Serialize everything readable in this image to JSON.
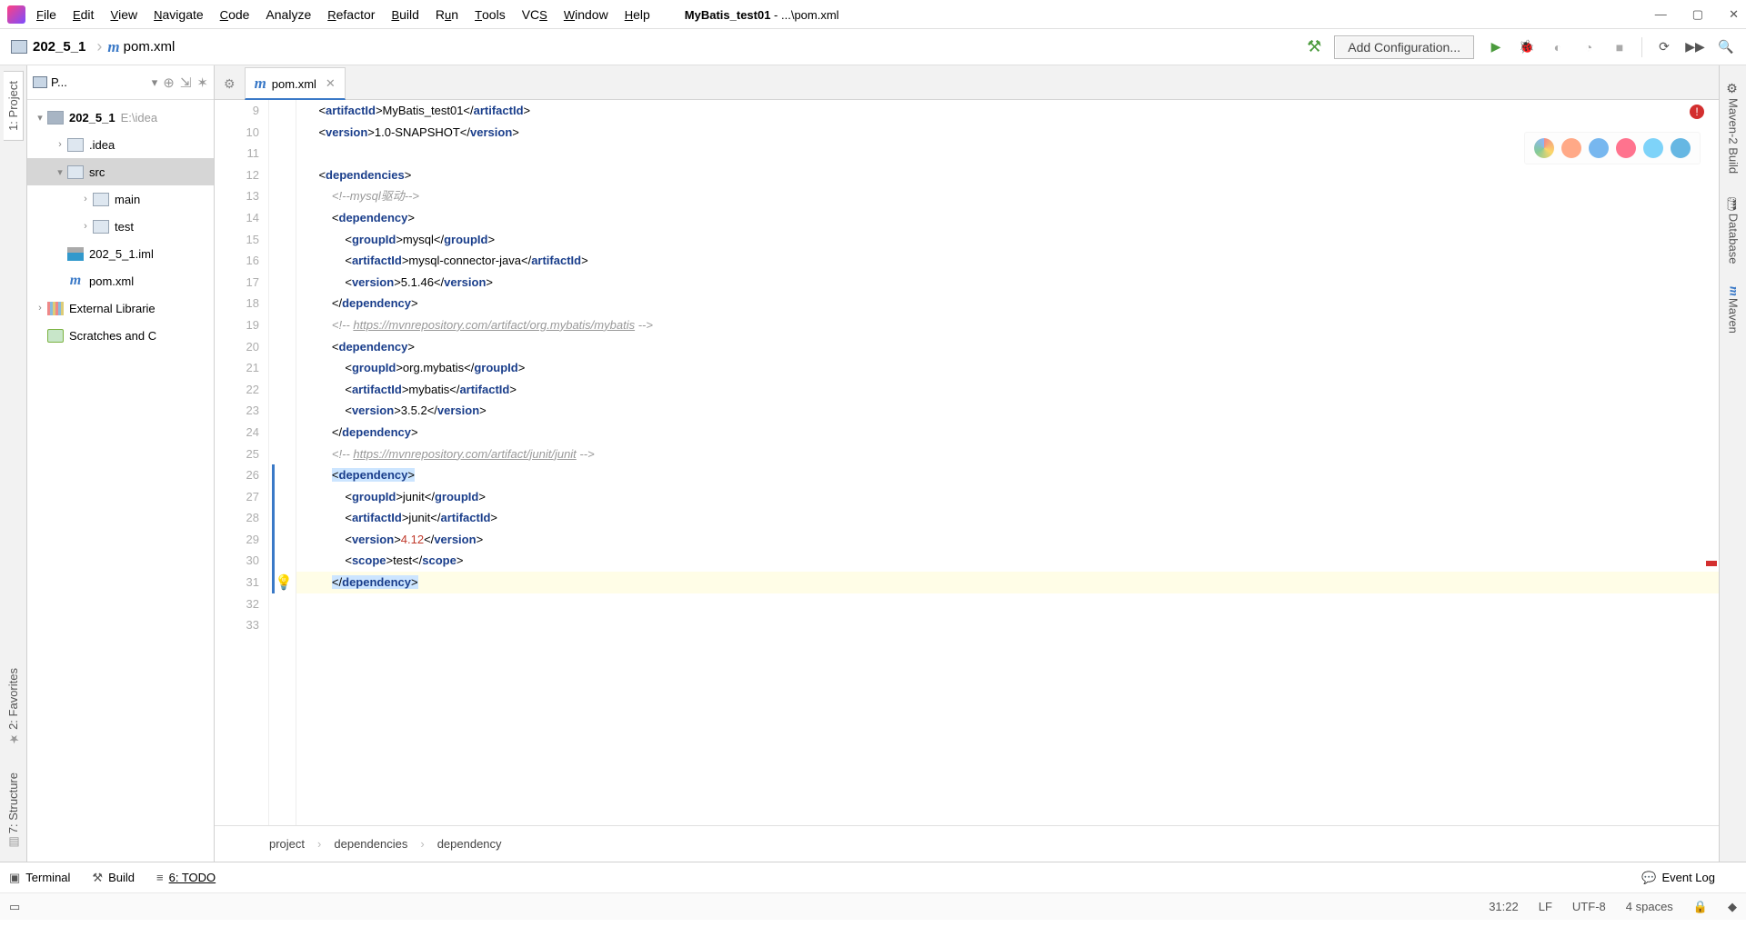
{
  "menu": {
    "items": [
      "File",
      "Edit",
      "View",
      "Navigate",
      "Code",
      "Analyze",
      "Refactor",
      "Build",
      "Run",
      "Tools",
      "VCS",
      "Window",
      "Help"
    ],
    "accel": [
      "F",
      "E",
      "V",
      "N",
      "C",
      "",
      "R",
      "B",
      "u",
      "T",
      "S",
      "W",
      "H"
    ],
    "title_project": "MyBatis_test01",
    "title_suffix": " - ...\\pom.xml"
  },
  "nav": {
    "project": "202_5_1",
    "file": "pom.xml",
    "addConfig": "Add Configuration..."
  },
  "leftTabs": {
    "project": "1: Project",
    "favorites": "2: Favorites",
    "structure": "7: Structure"
  },
  "rightTabs": {
    "mavenBuild": "Maven-2 Build",
    "database": "Database",
    "maven": "Maven"
  },
  "projectPane": {
    "title": "P...",
    "root": "202_5_1",
    "rootPath": "E:\\idea",
    "nodes": {
      "idea": ".idea",
      "src": "src",
      "main": "main",
      "test": "test",
      "iml": "202_5_1.iml",
      "pom": "pom.xml",
      "ext": "External Librarie",
      "scratch": "Scratches and C"
    }
  },
  "tab": {
    "name": "pom.xml"
  },
  "crumbs": {
    "a": "project",
    "b": "dependencies",
    "c": "dependency"
  },
  "status": {
    "terminal": "Terminal",
    "build": "Build",
    "todo": "6: TODO",
    "eventlog": "Event Log"
  },
  "info": {
    "pos": "31:22",
    "le": "LF",
    "enc": "UTF-8",
    "indent": "4 spaces"
  },
  "code": {
    "startLine": 9,
    "lines": [
      {
        "indent": 1,
        "type": "tag",
        "open": "artifactId",
        "text": "MyBatis_test01",
        "close": "artifactId"
      },
      {
        "indent": 1,
        "type": "tag",
        "open": "version",
        "text": "1.0-SNAPSHOT",
        "close": "version"
      },
      {
        "indent": 0,
        "type": "blank"
      },
      {
        "indent": 1,
        "type": "tago",
        "open": "dependencies"
      },
      {
        "indent": 2,
        "type": "comment",
        "text": "<!--mysql驱动-->"
      },
      {
        "indent": 2,
        "type": "tago",
        "open": "dependency"
      },
      {
        "indent": 3,
        "type": "tag",
        "open": "groupId",
        "text": "mysql",
        "close": "groupId"
      },
      {
        "indent": 3,
        "type": "tag",
        "open": "artifactId",
        "text": "mysql-connector-java",
        "close": "artifactId"
      },
      {
        "indent": 3,
        "type": "tag",
        "open": "version",
        "text": "5.1.46",
        "close": "version"
      },
      {
        "indent": 2,
        "type": "tagc",
        "close": "dependency"
      },
      {
        "indent": 2,
        "type": "commentlink",
        "pre": "<!-- ",
        "link": "https://mvnrepository.com/artifact/org.mybatis/mybatis",
        "post": " -->"
      },
      {
        "indent": 2,
        "type": "tago",
        "open": "dependency"
      },
      {
        "indent": 3,
        "type": "tag",
        "open": "groupId",
        "text": "org.mybatis",
        "close": "groupId"
      },
      {
        "indent": 3,
        "type": "tag",
        "open": "artifactId",
        "text": "mybatis",
        "close": "artifactId"
      },
      {
        "indent": 3,
        "type": "tag",
        "open": "version",
        "text": "3.5.2",
        "close": "version"
      },
      {
        "indent": 2,
        "type": "tagc",
        "close": "dependency"
      },
      {
        "indent": 2,
        "type": "commentlink",
        "pre": "<!-- ",
        "link": "https://mvnrepository.com/artifact/junit/junit",
        "post": " -->"
      },
      {
        "indent": 2,
        "type": "tago",
        "open": "dependency",
        "hl": true
      },
      {
        "indent": 3,
        "type": "tag",
        "open": "groupId",
        "text": "junit",
        "close": "groupId"
      },
      {
        "indent": 3,
        "type": "tag",
        "open": "artifactId",
        "text": "junit",
        "close": "artifactId"
      },
      {
        "indent": 3,
        "type": "tag",
        "open": "version",
        "text": "4.12",
        "close": "version",
        "err": true
      },
      {
        "indent": 3,
        "type": "tag",
        "open": "scope",
        "text": "test",
        "close": "scope"
      },
      {
        "indent": 2,
        "type": "tagc",
        "close": "dependency",
        "hl": true,
        "cur": true
      },
      {
        "indent": 0,
        "type": "blank"
      },
      {
        "indent": 0,
        "type": "blank"
      }
    ]
  }
}
